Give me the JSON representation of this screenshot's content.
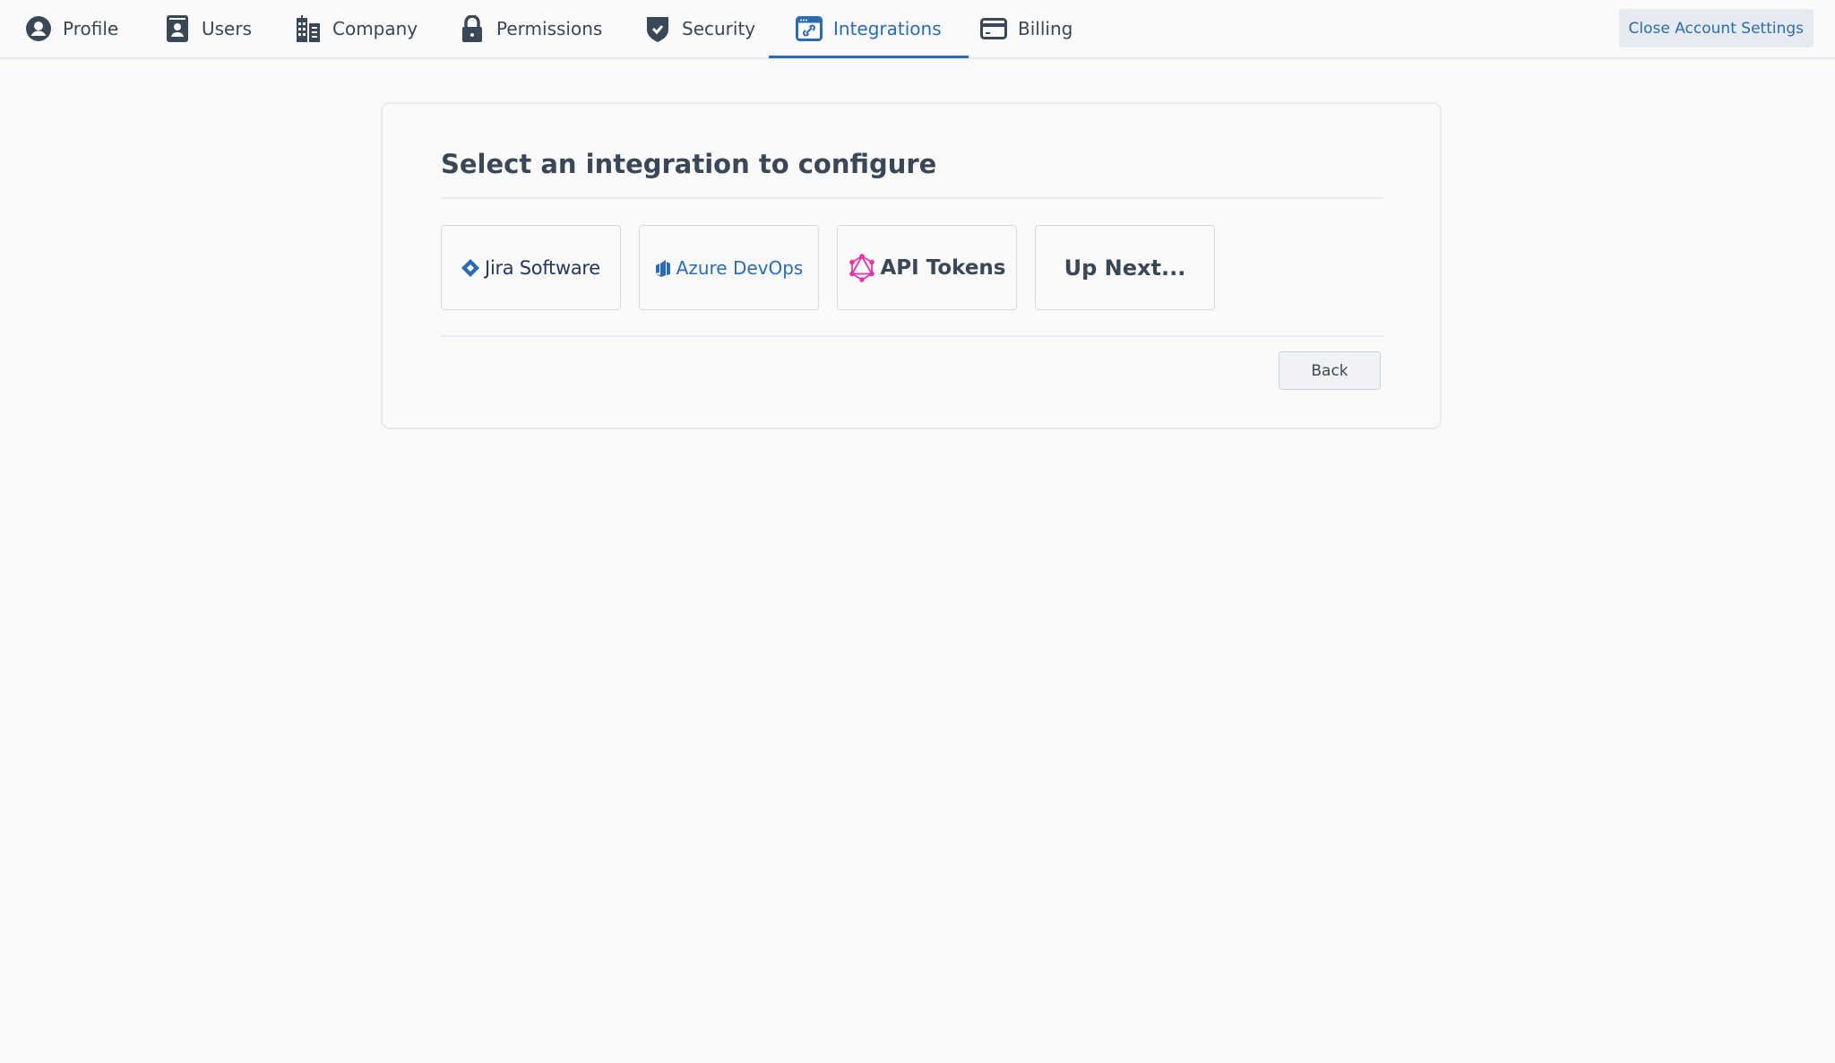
{
  "nav": {
    "tabs": [
      {
        "label": "Profile",
        "icon": "user-circle-icon",
        "active": false
      },
      {
        "label": "Users",
        "icon": "user-badge-icon",
        "active": false
      },
      {
        "label": "Company",
        "icon": "buildings-icon",
        "active": false
      },
      {
        "label": "Permissions",
        "icon": "lock-icon",
        "active": false
      },
      {
        "label": "Security",
        "icon": "shield-check-icon",
        "active": false
      },
      {
        "label": "Integrations",
        "icon": "link-window-icon",
        "active": true
      },
      {
        "label": "Billing",
        "icon": "credit-card-icon",
        "active": false
      }
    ],
    "close_label": "Close Account Settings"
  },
  "main": {
    "title": "Select an integration to configure",
    "integrations": [
      {
        "label": "Jira Software",
        "icon": "jira-logo-icon"
      },
      {
        "label": "Azure DevOps",
        "icon": "azure-devops-logo-icon"
      },
      {
        "label": "API Tokens",
        "icon": "graphql-logo-icon"
      },
      {
        "label": "Up Next..."
      }
    ],
    "back_label": "Back"
  },
  "colors": {
    "accent": "#2b6cb0",
    "text": "#3a4756",
    "graphql_pink": "#e535ab",
    "background": "#fafafa"
  }
}
